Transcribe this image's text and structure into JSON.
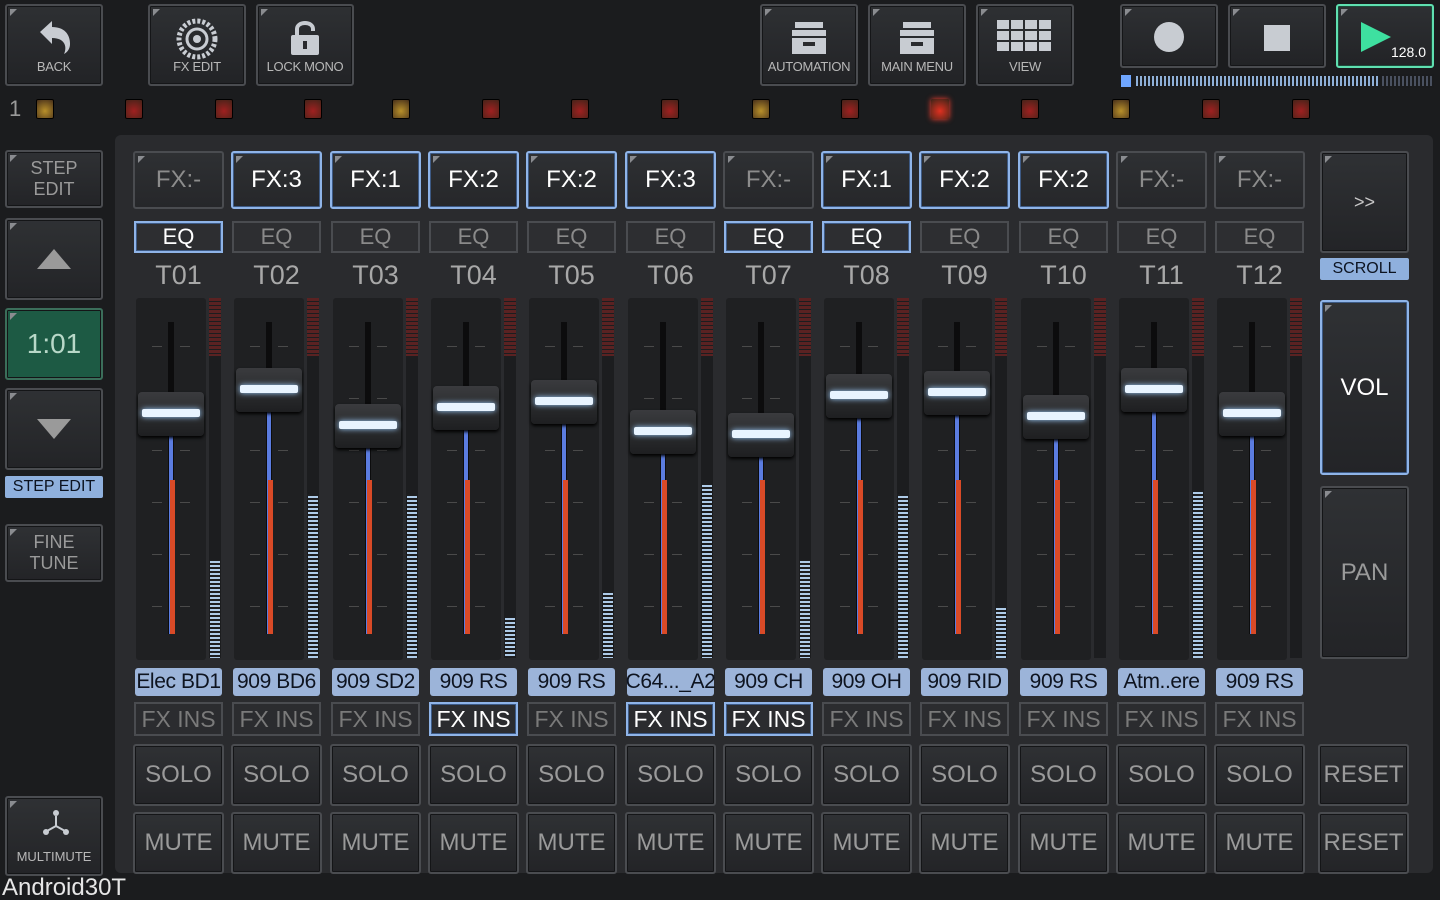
{
  "toolbar": {
    "back": "BACK",
    "fx_edit": "FX EDIT",
    "lock_mono": "LOCK MONO",
    "automation": "AUTOMATION",
    "main_menu": "MAIN MENU",
    "view": "VIEW",
    "tempo": "128.0"
  },
  "pattern_number": "1",
  "left": {
    "step_edit_top": [
      "STEP",
      "EDIT"
    ],
    "position": "1:01",
    "step_edit_tag": "STEP EDIT",
    "fine_tune": [
      "FINE",
      "TUNE"
    ],
    "multimute": "MULTIMUTE"
  },
  "right": {
    "scroll_arrow": ">>",
    "scroll": "SCROLL",
    "vol": "VOL",
    "pan": "PAN",
    "reset_solo": "RESET",
    "reset_mute": "RESET"
  },
  "watermark": "Android30T",
  "labels": {
    "eq": "EQ",
    "fx_ins": "FX INS",
    "solo": "SOLO",
    "mute": "MUTE"
  },
  "leds": [
    {
      "color": "#b8902a",
      "state": "yellow"
    },
    {
      "color": "#a02020",
      "state": "red"
    },
    {
      "color": "#a02020",
      "state": "red"
    },
    {
      "color": "#a02020",
      "state": "red"
    },
    {
      "color": "#b8902a",
      "state": "yellow"
    },
    {
      "color": "#a02020",
      "state": "red"
    },
    {
      "color": "#a02020",
      "state": "red"
    },
    {
      "color": "#a02020",
      "state": "red"
    },
    {
      "color": "#b8902a",
      "state": "yellow"
    },
    {
      "color": "#a02020",
      "state": "red"
    },
    {
      "color": "#e03020",
      "state": "bright"
    },
    {
      "color": "#a02020",
      "state": "red"
    },
    {
      "color": "#b8902a",
      "state": "yellow"
    },
    {
      "color": "#a02020",
      "state": "red"
    },
    {
      "color": "#a02020",
      "state": "red"
    }
  ],
  "tracks": [
    {
      "name": "T01",
      "fx": "FX:-",
      "fx_on": false,
      "eq_on": true,
      "instrument": "Elec BD1",
      "fx_ins_on": false,
      "fader_level": 0.82,
      "meter_level": 0.27
    },
    {
      "name": "T02",
      "fx": "FX:3",
      "fx_on": true,
      "eq_on": false,
      "instrument": "909 BD6",
      "fx_ins_on": false,
      "fader_level": 0.9,
      "meter_level": 0.45
    },
    {
      "name": "T03",
      "fx": "FX:1",
      "fx_on": true,
      "eq_on": false,
      "instrument": "909 SD2",
      "fx_ins_on": false,
      "fader_level": 0.78,
      "meter_level": 0.45
    },
    {
      "name": "T04",
      "fx": "FX:2",
      "fx_on": true,
      "eq_on": false,
      "instrument": "909 RS",
      "fx_ins_on": true,
      "fader_level": 0.84,
      "meter_level": 0.11
    },
    {
      "name": "T05",
      "fx": "FX:2",
      "fx_on": true,
      "eq_on": false,
      "instrument": "909 RS",
      "fx_ins_on": false,
      "fader_level": 0.86,
      "meter_level": 0.18
    },
    {
      "name": "T06",
      "fx": "FX:3",
      "fx_on": true,
      "eq_on": false,
      "instrument": "C64..._A2",
      "fx_ins_on": true,
      "fader_level": 0.76,
      "meter_level": 0.48
    },
    {
      "name": "T07",
      "fx": "FX:-",
      "fx_on": false,
      "eq_on": true,
      "instrument": "909 CH",
      "fx_ins_on": true,
      "fader_level": 0.75,
      "meter_level": 0.27
    },
    {
      "name": "T08",
      "fx": "FX:1",
      "fx_on": true,
      "eq_on": true,
      "instrument": "909 OH",
      "fx_ins_on": false,
      "fader_level": 0.88,
      "meter_level": 0.45
    },
    {
      "name": "T09",
      "fx": "FX:2",
      "fx_on": true,
      "eq_on": false,
      "instrument": "909 RID",
      "fx_ins_on": false,
      "fader_level": 0.89,
      "meter_level": 0.14
    },
    {
      "name": "T10",
      "fx": "FX:2",
      "fx_on": true,
      "eq_on": false,
      "instrument": "909 RS",
      "fx_ins_on": false,
      "fader_level": 0.81,
      "meter_level": 0.0
    },
    {
      "name": "T11",
      "fx": "FX:-",
      "fx_on": false,
      "eq_on": false,
      "instrument": "Atm..ere",
      "fx_ins_on": false,
      "fader_level": 0.9,
      "meter_level": 0.46
    },
    {
      "name": "T12",
      "fx": "FX:-",
      "fx_on": false,
      "eq_on": false,
      "instrument": "909 RS",
      "fx_ins_on": false,
      "fader_level": 0.82,
      "meter_level": 0.0
    }
  ]
}
